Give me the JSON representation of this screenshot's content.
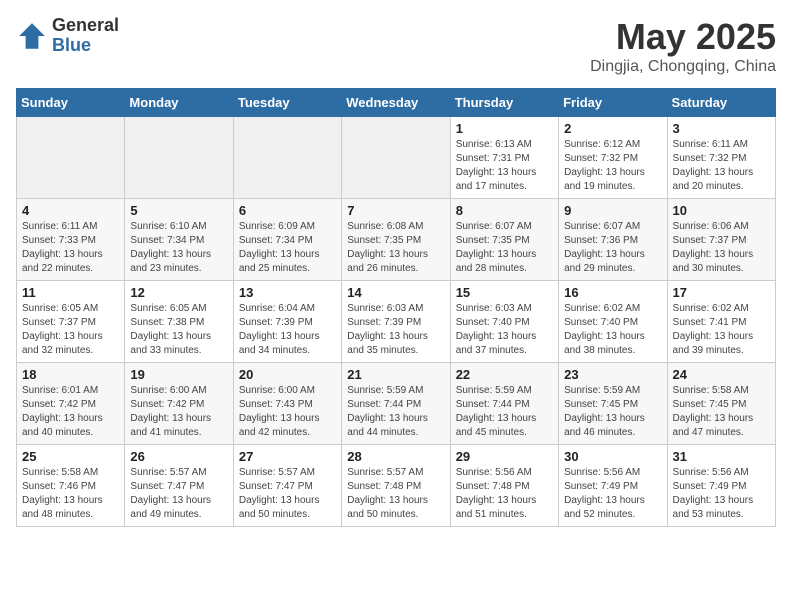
{
  "logo": {
    "general": "General",
    "blue": "Blue"
  },
  "title": "May 2025",
  "subtitle": "Dingjia, Chongqing, China",
  "days_of_week": [
    "Sunday",
    "Monday",
    "Tuesday",
    "Wednesday",
    "Thursday",
    "Friday",
    "Saturday"
  ],
  "weeks": [
    [
      {
        "day": "",
        "info": ""
      },
      {
        "day": "",
        "info": ""
      },
      {
        "day": "",
        "info": ""
      },
      {
        "day": "",
        "info": ""
      },
      {
        "day": "1",
        "info": "Sunrise: 6:13 AM\nSunset: 7:31 PM\nDaylight: 13 hours\nand 17 minutes."
      },
      {
        "day": "2",
        "info": "Sunrise: 6:12 AM\nSunset: 7:32 PM\nDaylight: 13 hours\nand 19 minutes."
      },
      {
        "day": "3",
        "info": "Sunrise: 6:11 AM\nSunset: 7:32 PM\nDaylight: 13 hours\nand 20 minutes."
      }
    ],
    [
      {
        "day": "4",
        "info": "Sunrise: 6:11 AM\nSunset: 7:33 PM\nDaylight: 13 hours\nand 22 minutes."
      },
      {
        "day": "5",
        "info": "Sunrise: 6:10 AM\nSunset: 7:34 PM\nDaylight: 13 hours\nand 23 minutes."
      },
      {
        "day": "6",
        "info": "Sunrise: 6:09 AM\nSunset: 7:34 PM\nDaylight: 13 hours\nand 25 minutes."
      },
      {
        "day": "7",
        "info": "Sunrise: 6:08 AM\nSunset: 7:35 PM\nDaylight: 13 hours\nand 26 minutes."
      },
      {
        "day": "8",
        "info": "Sunrise: 6:07 AM\nSunset: 7:35 PM\nDaylight: 13 hours\nand 28 minutes."
      },
      {
        "day": "9",
        "info": "Sunrise: 6:07 AM\nSunset: 7:36 PM\nDaylight: 13 hours\nand 29 minutes."
      },
      {
        "day": "10",
        "info": "Sunrise: 6:06 AM\nSunset: 7:37 PM\nDaylight: 13 hours\nand 30 minutes."
      }
    ],
    [
      {
        "day": "11",
        "info": "Sunrise: 6:05 AM\nSunset: 7:37 PM\nDaylight: 13 hours\nand 32 minutes."
      },
      {
        "day": "12",
        "info": "Sunrise: 6:05 AM\nSunset: 7:38 PM\nDaylight: 13 hours\nand 33 minutes."
      },
      {
        "day": "13",
        "info": "Sunrise: 6:04 AM\nSunset: 7:39 PM\nDaylight: 13 hours\nand 34 minutes."
      },
      {
        "day": "14",
        "info": "Sunrise: 6:03 AM\nSunset: 7:39 PM\nDaylight: 13 hours\nand 35 minutes."
      },
      {
        "day": "15",
        "info": "Sunrise: 6:03 AM\nSunset: 7:40 PM\nDaylight: 13 hours\nand 37 minutes."
      },
      {
        "day": "16",
        "info": "Sunrise: 6:02 AM\nSunset: 7:40 PM\nDaylight: 13 hours\nand 38 minutes."
      },
      {
        "day": "17",
        "info": "Sunrise: 6:02 AM\nSunset: 7:41 PM\nDaylight: 13 hours\nand 39 minutes."
      }
    ],
    [
      {
        "day": "18",
        "info": "Sunrise: 6:01 AM\nSunset: 7:42 PM\nDaylight: 13 hours\nand 40 minutes."
      },
      {
        "day": "19",
        "info": "Sunrise: 6:00 AM\nSunset: 7:42 PM\nDaylight: 13 hours\nand 41 minutes."
      },
      {
        "day": "20",
        "info": "Sunrise: 6:00 AM\nSunset: 7:43 PM\nDaylight: 13 hours\nand 42 minutes."
      },
      {
        "day": "21",
        "info": "Sunrise: 5:59 AM\nSunset: 7:44 PM\nDaylight: 13 hours\nand 44 minutes."
      },
      {
        "day": "22",
        "info": "Sunrise: 5:59 AM\nSunset: 7:44 PM\nDaylight: 13 hours\nand 45 minutes."
      },
      {
        "day": "23",
        "info": "Sunrise: 5:59 AM\nSunset: 7:45 PM\nDaylight: 13 hours\nand 46 minutes."
      },
      {
        "day": "24",
        "info": "Sunrise: 5:58 AM\nSunset: 7:45 PM\nDaylight: 13 hours\nand 47 minutes."
      }
    ],
    [
      {
        "day": "25",
        "info": "Sunrise: 5:58 AM\nSunset: 7:46 PM\nDaylight: 13 hours\nand 48 minutes."
      },
      {
        "day": "26",
        "info": "Sunrise: 5:57 AM\nSunset: 7:47 PM\nDaylight: 13 hours\nand 49 minutes."
      },
      {
        "day": "27",
        "info": "Sunrise: 5:57 AM\nSunset: 7:47 PM\nDaylight: 13 hours\nand 50 minutes."
      },
      {
        "day": "28",
        "info": "Sunrise: 5:57 AM\nSunset: 7:48 PM\nDaylight: 13 hours\nand 50 minutes."
      },
      {
        "day": "29",
        "info": "Sunrise: 5:56 AM\nSunset: 7:48 PM\nDaylight: 13 hours\nand 51 minutes."
      },
      {
        "day": "30",
        "info": "Sunrise: 5:56 AM\nSunset: 7:49 PM\nDaylight: 13 hours\nand 52 minutes."
      },
      {
        "day": "31",
        "info": "Sunrise: 5:56 AM\nSunset: 7:49 PM\nDaylight: 13 hours\nand 53 minutes."
      }
    ]
  ]
}
